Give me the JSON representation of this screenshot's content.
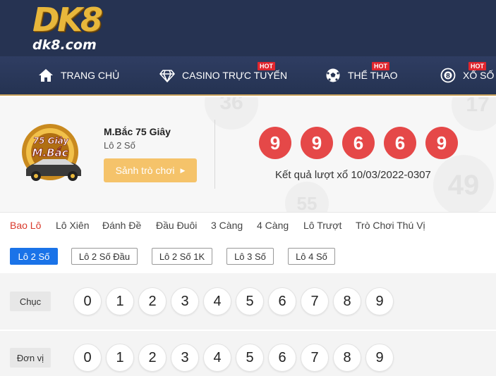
{
  "brand": {
    "logo_text": "DK8",
    "domain": "dk8.com"
  },
  "nav": {
    "items": [
      {
        "label": "TRANG CHỦ",
        "icon": "home-icon",
        "hot": ""
      },
      {
        "label": "CASINO TRỰC TUYẾN",
        "icon": "diamond-icon",
        "hot": "HOT"
      },
      {
        "label": "THỂ THAO",
        "icon": "soccer-ball-icon",
        "hot": "HOT"
      },
      {
        "label": "XỔ SỐ",
        "icon": "lottery-ball-icon",
        "hot": "HOT"
      }
    ]
  },
  "game": {
    "logo_text_top": "75 Giây",
    "logo_text_bottom": "M.Bắc",
    "title": "M.Bắc 75 Giây",
    "subtitle": "Lô 2 Số",
    "lobby_button": "Sảnh trò chơi",
    "result_numbers": [
      "9",
      "9",
      "6",
      "6",
      "9"
    ],
    "result_label": "Kết quả lượt xổ 10/03/2022-0307"
  },
  "background_balls": [
    "36",
    "17",
    "49",
    "55"
  ],
  "tabs": [
    "Bao Lô",
    "Lô Xiên",
    "Đánh Đề",
    "Đầu Đuôi",
    "3 Càng",
    "4 Càng",
    "Lô Trượt",
    "Trò Chơi Thú Vị"
  ],
  "active_tab": "Bao Lô",
  "subtabs": [
    "Lô 2 Số",
    "Lô 2 Số Đầu",
    "Lô 2 Số 1K",
    "Lô 3 Số",
    "Lô 4 Số"
  ],
  "active_subtab": "Lô 2 Số",
  "rows": [
    {
      "label": "Chục",
      "numbers": [
        "0",
        "1",
        "2",
        "3",
        "4",
        "5",
        "6",
        "7",
        "8",
        "9"
      ]
    },
    {
      "label": "Đơn vị",
      "numbers": [
        "0",
        "1",
        "2",
        "3",
        "4",
        "5",
        "6",
        "7",
        "8",
        "9"
      ]
    }
  ],
  "colors": {
    "header_bg": "#263352",
    "logo_gold": "#e8b73b",
    "hot_badge": "#e0262e",
    "result_ball": "#e54848",
    "lobby_button": "#f5c36a",
    "active_tab": "#d9392b",
    "active_subtab": "#1a73e8"
  }
}
